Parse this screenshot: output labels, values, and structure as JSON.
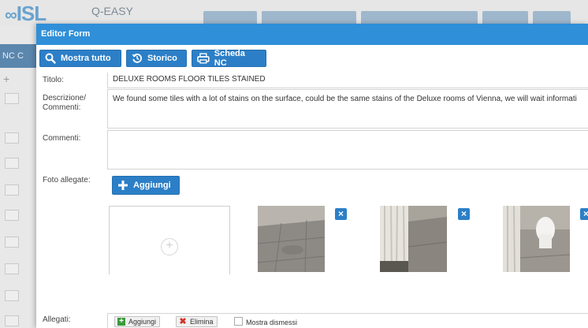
{
  "app": {
    "logo": "ISL",
    "logo_sub": "Q-EASY"
  },
  "sidebar": {
    "section_label": "NC C"
  },
  "modal": {
    "title": "Editor Form",
    "toolbar": {
      "show_all": "Mostra tutto",
      "history": "Storico",
      "nc_sheet": "Scheda NC"
    },
    "form": {
      "title_label": "Titolo:",
      "title_value": "DELUXE ROOMS FLOOR TILES STAINED",
      "description_label_1": "Descrizione/",
      "description_label_2": "Commenti:",
      "description_value": "We found some tiles with a lot of stains on the surface, could be the same stains of the Deluxe rooms of Vienna, we will wait informati",
      "comments_label": "Commenti:",
      "comments_value": "",
      "photos_label": "Foto allegate:",
      "add_photo": "Aggiungi",
      "attachments_label": "Allegati:",
      "attach_add": "Aggiungi",
      "attach_delete": "Elimina",
      "show_dismissed": "Mostra dismessi"
    }
  },
  "colors": {
    "header": "#2f8fd8",
    "button": "#2c7fc7",
    "sidebar_active": "#5b86ad"
  }
}
